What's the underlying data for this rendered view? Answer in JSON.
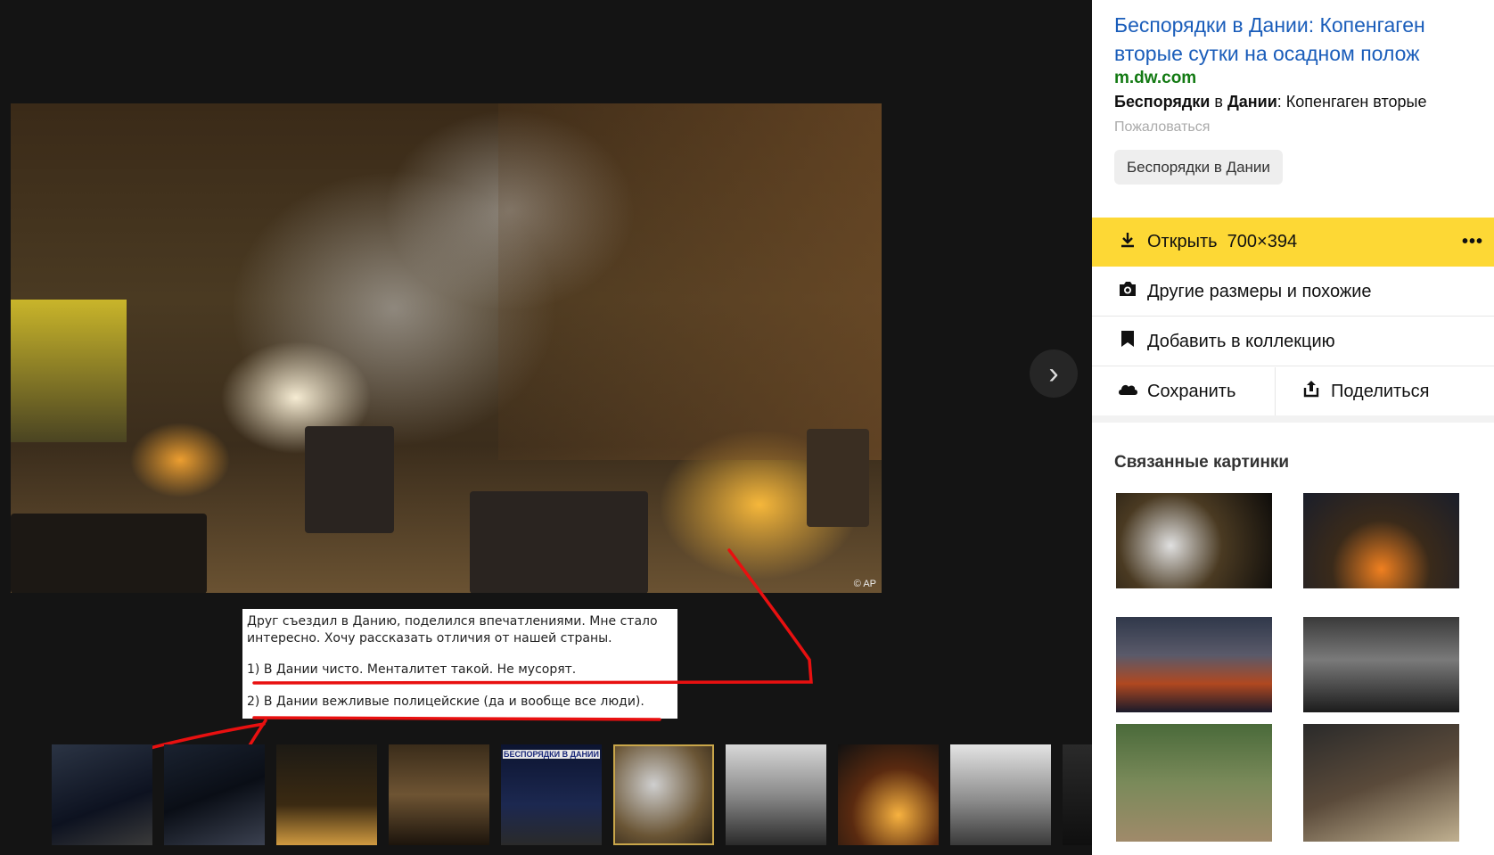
{
  "viewer": {
    "image_credit": "© AP",
    "next_icon": "chevron-right-icon",
    "note": {
      "line1": "Друг съездил в Данию, поделился впечатлениями. Мне стало",
      "line2": "интересно. Хочу рассказать отличия от нашей страны.",
      "item1": "1) В Дании чисто. Менталитет такой. Не мусорят.",
      "item2": "2) В Дании вежливые полицейские (да и вообще все люди)."
    },
    "annotation_color": "#e81010",
    "thumbnails": [
      {
        "caption": ""
      },
      {
        "caption": ""
      },
      {
        "caption": ""
      },
      {
        "caption": ""
      },
      {
        "caption": "БЕСПОРЯДКИ В ДАНИИ"
      },
      {
        "caption": ""
      },
      {
        "caption": ""
      },
      {
        "caption": ""
      },
      {
        "caption": ""
      },
      {
        "caption": ""
      }
    ]
  },
  "sidebar": {
    "title": "Беспорядки в Дании: Копенгаген вторые сутки на осадном полож",
    "title_line1": "Беспорядки в Дании: Копенгаген",
    "title_line2": "вторые сутки на осадном полож",
    "domain": "m.dw.com",
    "snippet_bold": "Беспорядки",
    "snippet_mid": " в ",
    "snippet_bold2": "Дании",
    "snippet_rest": ": Копенгаген вторые",
    "complain": "Пожаловаться",
    "tag": "Беспорядки в Дании",
    "open_label": "Открыть",
    "open_size": "700×394",
    "more": "•••",
    "other_sizes": "Другие размеры и похожие",
    "add_collection": "Добавить в коллекцию",
    "save": "Сохранить",
    "share": "Поделиться",
    "related_title": "Связанные картинки",
    "accent": "#fdd835",
    "link_color": "#1a5dba",
    "domain_color": "#137a13"
  }
}
